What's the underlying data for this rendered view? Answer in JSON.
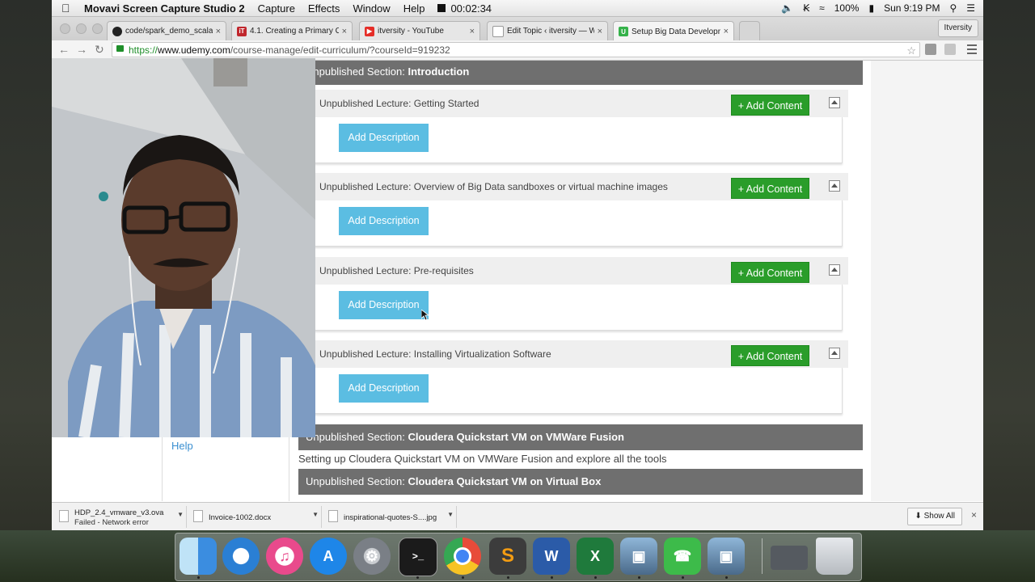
{
  "menubar": {
    "app_name": "Movavi Screen Capture Studio 2",
    "menus": [
      "Capture",
      "Effects",
      "Window",
      "Help"
    ],
    "timer": "00:02:34",
    "battery": "100%",
    "clock": "Sun 9:19 PM"
  },
  "tabs": [
    {
      "title": "code/spark_demo_scala.txt",
      "favicon": "github-icon",
      "color": "#222222"
    },
    {
      "title": "4.1. Creating a Primary Co",
      "favicon": "itversity-icon",
      "color": "#c0272d"
    },
    {
      "title": "itversity - YouTube",
      "favicon": "youtube-icon",
      "color": "#e52d27"
    },
    {
      "title": "Edit Topic ‹ itversity — Wo",
      "favicon": "page-icon",
      "color": "#888888"
    },
    {
      "title": "Setup Big Data Developme",
      "favicon": "udemy-icon",
      "color": "#35b24a"
    }
  ],
  "profile": "Itversity",
  "address": {
    "https": "https://",
    "host": "www.udemy.com",
    "path": "/course-manage/edit-curriculum/?courseId=919232"
  },
  "sections": [
    {
      "prefix": "Unpublished Section: ",
      "name": "Introduction"
    },
    {
      "prefix": "Unpublished Section: ",
      "name": "Cloudera Quickstart VM on VMWare Fusion",
      "description": "Setting up Cloudera Quickstart VM on VMWare Fusion and explore all the tools"
    },
    {
      "prefix": "Unpublished Section: ",
      "name": "Cloudera Quickstart VM on Virtual Box"
    }
  ],
  "lectures": [
    {
      "title": "Unpublished Lecture: Getting Started"
    },
    {
      "title": "Unpublished Lecture: Overview of Big Data sandboxes or virtual machine images"
    },
    {
      "title": "Unpublished Lecture: Pre-requisites"
    },
    {
      "title": "Unpublished Lecture: Installing Virtualization Software"
    }
  ],
  "buttons": {
    "add_content": "+ Add Content",
    "add_description": "Add Description"
  },
  "sidebar": {
    "help": "Help"
  },
  "downloads": [
    {
      "name": "HDP_2.4_vmware_v3.ova",
      "status": "Failed - Network error"
    },
    {
      "name": "Invoice-1002.docx",
      "status": ""
    },
    {
      "name": "inspirational-quotes-S....jpg",
      "status": ""
    }
  ],
  "show_all": "Show All",
  "dock": [
    {
      "name": "finder-icon",
      "color": "#3b8de0"
    },
    {
      "name": "safari-icon",
      "color": "#2a7fd4"
    },
    {
      "name": "itunes-icon",
      "color": "#e94a8c"
    },
    {
      "name": "app-store-icon",
      "color": "#1e86e8"
    },
    {
      "name": "system-preferences-icon",
      "color": "#7a7f86"
    },
    {
      "name": "terminal-icon",
      "color": "#1b1b1b"
    },
    {
      "name": "chrome-icon",
      "color": "#e84b3a"
    },
    {
      "name": "sublime-text-icon",
      "color": "#3c3c3c"
    },
    {
      "name": "word-icon",
      "color": "#2b5ba8"
    },
    {
      "name": "excel-icon",
      "color": "#1f7a3c"
    },
    {
      "name": "screen-capture-icon",
      "color": "#4a6a8a"
    },
    {
      "name": "facetime-icon",
      "color": "#3dbb4a"
    },
    {
      "name": "movavi-icon",
      "color": "#4a6a8a"
    },
    {
      "name": "downloads-stack-icon",
      "color": "#555a60"
    },
    {
      "name": "trash-icon",
      "color": "#c9cdd1"
    }
  ]
}
